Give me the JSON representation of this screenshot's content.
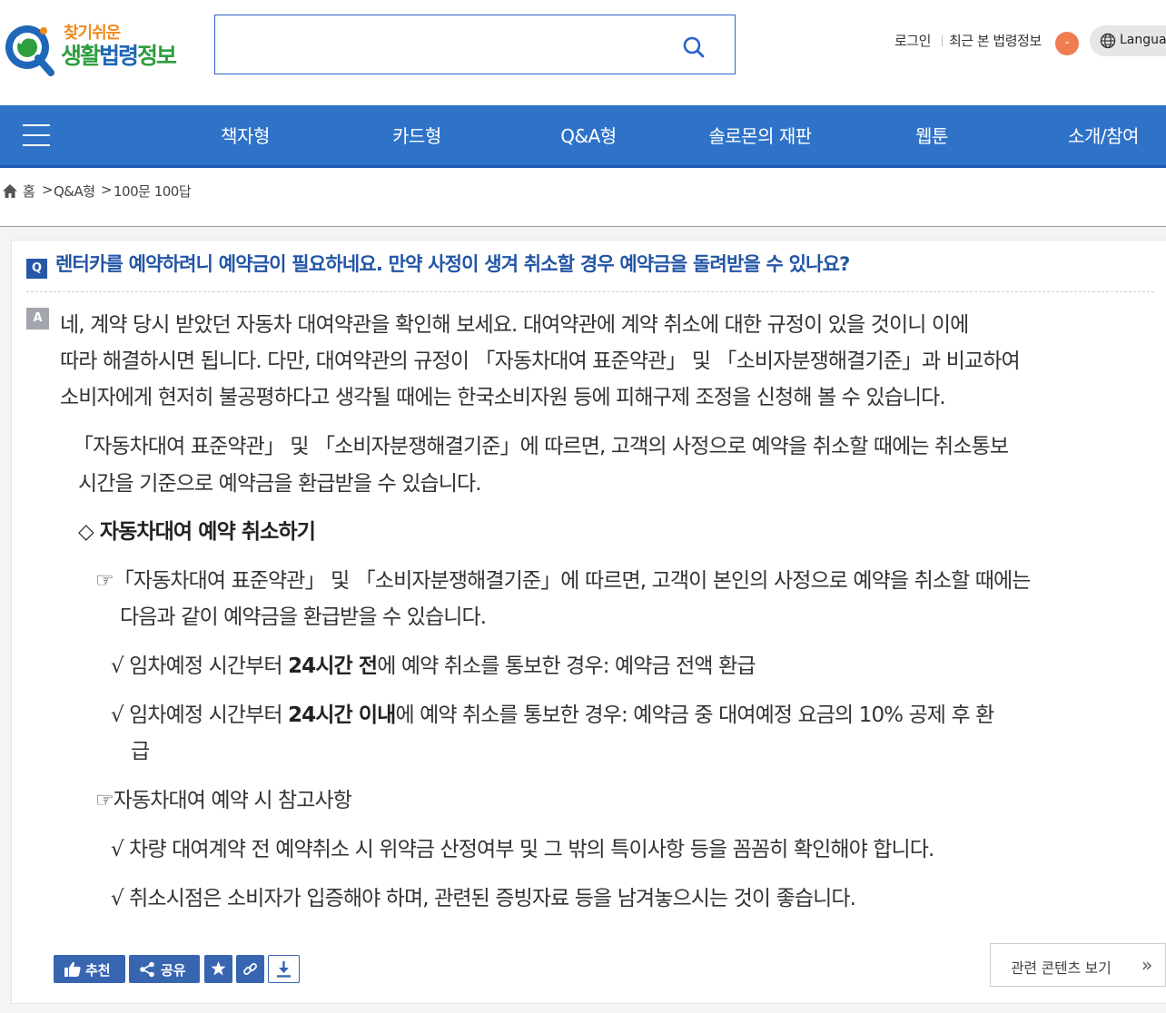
{
  "header": {
    "logo_small": "찾기쉬운",
    "logo_big_1": "생활",
    "logo_big_2": "법령",
    "logo_big_3": "정보",
    "search_value": "",
    "login": "로그인",
    "recent": "최근 본 법령정보",
    "recent_badge": "-",
    "language": "Language"
  },
  "nav": {
    "items": [
      "책자형",
      "카드형",
      "Q&A형",
      "솔로몬의 재판",
      "웹툰",
      "소개/참여"
    ]
  },
  "breadcrumb": {
    "home": "홈",
    "sep": ">",
    "level1": "Q&A형",
    "level2": "100문 100답"
  },
  "qa": {
    "q_badge": "Q",
    "question": "렌터카를 예약하려니 예약금이 필요하네요. 만약 사정이 생겨 취소할 경우 예약금을 돌려받을 수 있나요?",
    "a_badge": "A",
    "answer_lines": [
      "네, 계약 당시 받았던 자동차 대여약관을 확인해 보세요. 대여약관에 계약 취소에 대한 규정이 있을 것이니 이에",
      "따라 해결하시면 됩니다. 다만, 대여약관의 규정이 「자동차대여 표준약관」 및 「소비자분쟁해결기준」과 비교하여",
      "소비자에게 현저히 불공평하다고 생각될 때에는 한국소비자원 등에 피해구제 조정을 신청해 볼 수 있습니다."
    ],
    "para2_lines": [
      "「자동차대여 표준약관」 및 「소비자분쟁해결기준」에 따르면, 고객의 사정으로 예약을 취소할 때에는 취소통보",
      "시간을 기준으로 예약금을 환급받을 수 있습니다."
    ],
    "section_title": "◇ 자동차대여 예약 취소하기",
    "point1_lines": [
      "☞「자동차대여 표준약관」 및 「소비자분쟁해결기준」에 따르면, 고객이 본인의 사정으로 예약을 취소할 때에는",
      "다음과 같이 예약금을 환급받을 수 있습니다."
    ],
    "check1_pre": "√ 임차예정 시간부터 ",
    "check1_bold": "24시간 전",
    "check1_post": "에 예약 취소를 통보한 경우: 예약금 전액 환급",
    "check2_pre": "√ 임차예정 시간부터 ",
    "check2_bold": "24시간 이내",
    "check2_post": "에 예약 취소를 통보한 경우: 예약금 중 대여예정 요금의 10% 공제 후 환",
    "check2_cont": "급",
    "point2": "☞자동차대여 예약 시 참고사항",
    "check3": "√ 차량 대여계약 전 예약취소 시 위약금 산정여부 및 그 밖의 특이사항 등을 꼼꼼히 확인해야 합니다.",
    "check4": "√ 취소시점은 소비자가 입증해야 하며, 관련된 증빙자료 등을 남겨놓으시는 것이 좋습니다."
  },
  "actions": {
    "recommend": "추천",
    "share": "공유",
    "related": "관련 콘텐츠 보기",
    "related_arrow": "»"
  },
  "colors": {
    "brand_blue": "#2f73c9",
    "question_blue": "#2255a5",
    "button_blue": "#3865b0",
    "logo_orange": "#f08a1d",
    "logo_green": "#2e9e3e"
  }
}
